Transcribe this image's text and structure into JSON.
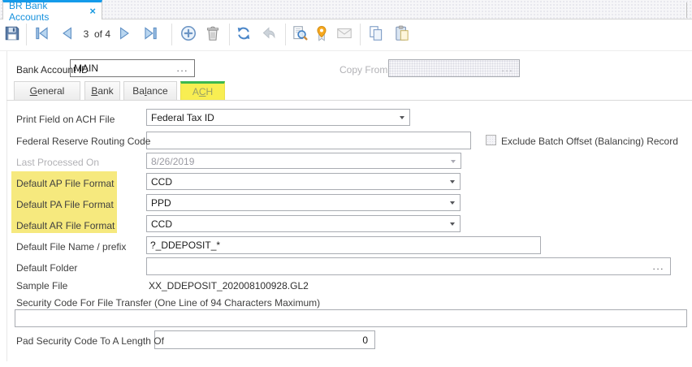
{
  "colors": {
    "accent_blue": "#149bea",
    "tab_selected_yellow": "#f8ee52",
    "tab_selected_green": "#3cb84e",
    "highlight_yellow": "#f6e97e"
  },
  "doc_tab": {
    "title": "BR Bank Accounts",
    "close_glyph": "×"
  },
  "toolbar": {
    "record_position": "3",
    "record_total": "of 4"
  },
  "header": {
    "bank_account_id": {
      "label": "Bank Account ID",
      "value": "MAIN",
      "ellipsis": "..."
    },
    "copy_from": {
      "label": "Copy From",
      "value": "",
      "ellipsis": "..."
    }
  },
  "tabs": {
    "general": {
      "pre": "",
      "key": "G",
      "post": "eneral"
    },
    "bank": {
      "pre": "",
      "key": "B",
      "post": "ank"
    },
    "balance": {
      "pre": "Ba",
      "key": "l",
      "post": "ance"
    },
    "ach": {
      "pre": "A",
      "key": "C",
      "post": "H"
    }
  },
  "form": {
    "print_field": {
      "label": "Print Field on ACH File",
      "value": "Federal Tax ID"
    },
    "routing_code": {
      "label": "Federal Reserve Routing Code",
      "value": ""
    },
    "exclude_offset": {
      "label": "Exclude Batch Offset (Balancing) Record",
      "checked": false
    },
    "last_processed": {
      "label": "Last Processed On",
      "value": "8/26/2019"
    },
    "ap_format": {
      "label": "Default AP File Format",
      "value": "CCD"
    },
    "pa_format": {
      "label": "Default PA File Format",
      "value": "PPD"
    },
    "ar_format": {
      "label": "Default AR File Format",
      "value": "CCD"
    },
    "file_name": {
      "label": "Default File Name / prefix",
      "value": "?_DDEPOSIT_*"
    },
    "folder": {
      "label": "Default Folder",
      "value": "",
      "ellipsis": "..."
    },
    "sample_file": {
      "label": "Sample File",
      "value": "XX_DDEPOSIT_202008100928.GL2"
    },
    "security_code": {
      "label": "Security Code For File Transfer (One Line of  94 Characters Maximum)",
      "value": ""
    },
    "pad_length": {
      "label": "Pad Security Code To A Length Of",
      "value": "0"
    }
  }
}
